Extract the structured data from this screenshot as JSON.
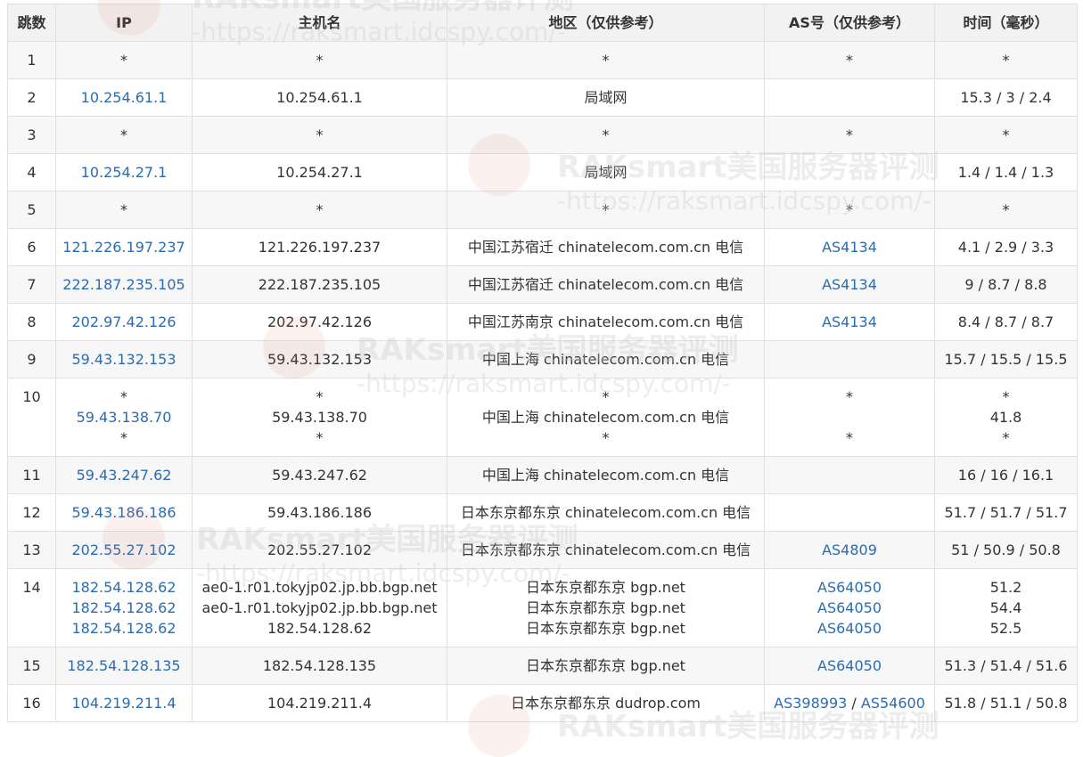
{
  "headers": [
    "跳数",
    "IP",
    "主机名",
    "地区（仅供参考）",
    "AS号（仅供参考）",
    "时间（毫秒）"
  ],
  "rows": [
    {
      "hop": "1",
      "ip": [
        "*"
      ],
      "host": [
        "*"
      ],
      "region": [
        "*"
      ],
      "as": [
        "*"
      ],
      "time": [
        "*"
      ]
    },
    {
      "hop": "2",
      "ip": [
        "10.254.61.1"
      ],
      "host": [
        "10.254.61.1"
      ],
      "region": [
        "局域网"
      ],
      "as": [
        ""
      ],
      "time": [
        "15.3 / 3 / 2.4"
      ]
    },
    {
      "hop": "3",
      "ip": [
        "*"
      ],
      "host": [
        "*"
      ],
      "region": [
        "*"
      ],
      "as": [
        "*"
      ],
      "time": [
        "*"
      ]
    },
    {
      "hop": "4",
      "ip": [
        "10.254.27.1"
      ],
      "host": [
        "10.254.27.1"
      ],
      "region": [
        "局域网"
      ],
      "as": [
        ""
      ],
      "time": [
        "1.4 / 1.4 / 1.3"
      ]
    },
    {
      "hop": "5",
      "ip": [
        "*"
      ],
      "host": [
        "*"
      ],
      "region": [
        "*"
      ],
      "as": [
        "*"
      ],
      "time": [
        "*"
      ]
    },
    {
      "hop": "6",
      "ip": [
        "121.226.197.237"
      ],
      "host": [
        "121.226.197.237"
      ],
      "region": [
        "中国江苏宿迁 chinatelecom.com.cn 电信"
      ],
      "as": [
        "AS4134"
      ],
      "time": [
        "4.1 / 2.9 / 3.3"
      ]
    },
    {
      "hop": "7",
      "ip": [
        "222.187.235.105"
      ],
      "host": [
        "222.187.235.105"
      ],
      "region": [
        "中国江苏宿迁 chinatelecom.com.cn 电信"
      ],
      "as": [
        "AS4134"
      ],
      "time": [
        "9 / 8.7 / 8.8"
      ]
    },
    {
      "hop": "8",
      "ip": [
        "202.97.42.126"
      ],
      "host": [
        "202.97.42.126"
      ],
      "region": [
        "中国江苏南京 chinatelecom.com.cn 电信"
      ],
      "as": [
        "AS4134"
      ],
      "time": [
        "8.4 / 8.7 / 8.7"
      ]
    },
    {
      "hop": "9",
      "ip": [
        "59.43.132.153"
      ],
      "host": [
        "59.43.132.153"
      ],
      "region": [
        "中国上海 chinatelecom.com.cn 电信"
      ],
      "as": [
        ""
      ],
      "time": [
        "15.7 / 15.5 / 15.5"
      ]
    },
    {
      "hop": "10",
      "ip": [
        "*",
        "59.43.138.70",
        "*"
      ],
      "host": [
        "*",
        "59.43.138.70",
        "*"
      ],
      "region": [
        "*",
        "中国上海 chinatelecom.com.cn 电信",
        "*"
      ],
      "as": [
        "*",
        "",
        "*"
      ],
      "time": [
        "*",
        "41.8",
        "*"
      ]
    },
    {
      "hop": "11",
      "ip": [
        "59.43.247.62"
      ],
      "host": [
        "59.43.247.62"
      ],
      "region": [
        "中国上海 chinatelecom.com.cn 电信"
      ],
      "as": [
        ""
      ],
      "time": [
        "16 / 16 / 16.1"
      ]
    },
    {
      "hop": "12",
      "ip": [
        "59.43.186.186"
      ],
      "host": [
        "59.43.186.186"
      ],
      "region": [
        "日本东京都东京 chinatelecom.com.cn 电信"
      ],
      "as": [
        ""
      ],
      "time": [
        "51.7 / 51.7 / 51.7"
      ]
    },
    {
      "hop": "13",
      "ip": [
        "202.55.27.102"
      ],
      "host": [
        "202.55.27.102"
      ],
      "region": [
        "日本东京都东京 chinatelecom.com.cn 电信"
      ],
      "as": [
        "AS4809"
      ],
      "time": [
        "51 / 50.9 / 50.8"
      ]
    },
    {
      "hop": "14",
      "ip": [
        "182.54.128.62",
        "182.54.128.62",
        "182.54.128.62"
      ],
      "host": [
        "ae0-1.r01.tokyjp02.jp.bb.bgp.net",
        "ae0-1.r01.tokyjp02.jp.bb.bgp.net",
        "182.54.128.62"
      ],
      "region": [
        "日本东京都东京 bgp.net",
        "日本东京都东京 bgp.net",
        "日本东京都东京 bgp.net"
      ],
      "as": [
        "AS64050",
        "AS64050",
        "AS64050"
      ],
      "time": [
        "51.2",
        "54.4",
        "52.5"
      ]
    },
    {
      "hop": "15",
      "ip": [
        "182.54.128.135"
      ],
      "host": [
        "182.54.128.135"
      ],
      "region": [
        "日本东京都东京 bgp.net"
      ],
      "as": [
        "AS64050"
      ],
      "time": [
        "51.3 / 51.4 / 51.6"
      ]
    },
    {
      "hop": "16",
      "ip": [
        "104.219.211.4"
      ],
      "host": [
        "104.219.211.4"
      ],
      "region": [
        "日本东京都东京 dudrop.com"
      ],
      "as": [
        "AS398993 / AS54600"
      ],
      "time": [
        "51.8 / 51.1 / 50.8"
      ]
    }
  ],
  "watermark": {
    "brand": "RAKsmart美国服务器评测",
    "url": "-https://raksmart.idcspy.com/-"
  },
  "colors": {
    "link": "#2b6cb0",
    "header_bg": "#f2f2f2",
    "alt_row_bg": "#f7f7f7",
    "border": "#e0e0e0"
  }
}
